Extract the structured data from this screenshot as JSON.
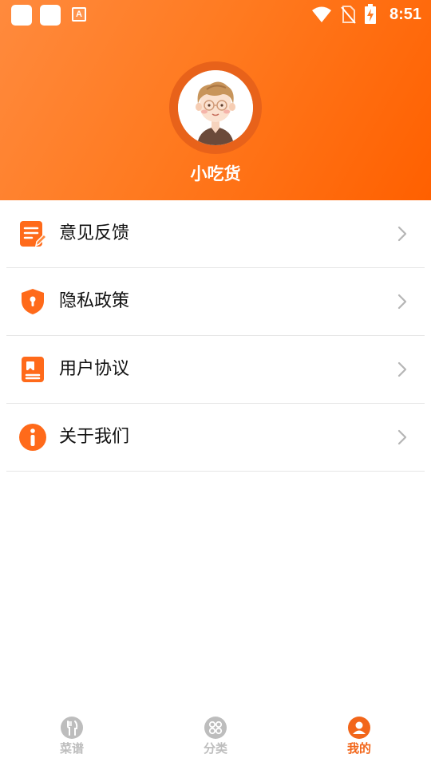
{
  "status_bar": {
    "time": "8:51",
    "notification_app_icon": "A",
    "icons": [
      "notification-box-icon",
      "notification-box-icon",
      "app-notification-icon",
      "wifi-icon",
      "no-sim-icon",
      "battery-charging-icon"
    ]
  },
  "profile": {
    "avatar_icon": "cartoon-boy-avatar-icon",
    "name": "小吃货"
  },
  "menu": {
    "items": [
      {
        "label": "意见反馈",
        "icon": "feedback-edit-icon"
      },
      {
        "label": "隐私政策",
        "icon": "privacy-shield-icon"
      },
      {
        "label": "用户协议",
        "icon": "user-agreement-document-icon"
      },
      {
        "label": "关于我们",
        "icon": "about-info-icon"
      }
    ]
  },
  "bottom_nav": {
    "items": [
      {
        "label": "菜谱",
        "icon": "fork-knife-icon",
        "active": false
      },
      {
        "label": "分类",
        "icon": "category-grid-icon",
        "active": false
      },
      {
        "label": "我的",
        "icon": "profile-user-icon",
        "active": true
      }
    ]
  },
  "colors": {
    "accent": "#f2661a",
    "header_gradient_start": "#ff8a3d",
    "header_gradient_end": "#ff6000",
    "inactive_nav": "#bdbdbd",
    "divider": "#e6e6e6"
  }
}
